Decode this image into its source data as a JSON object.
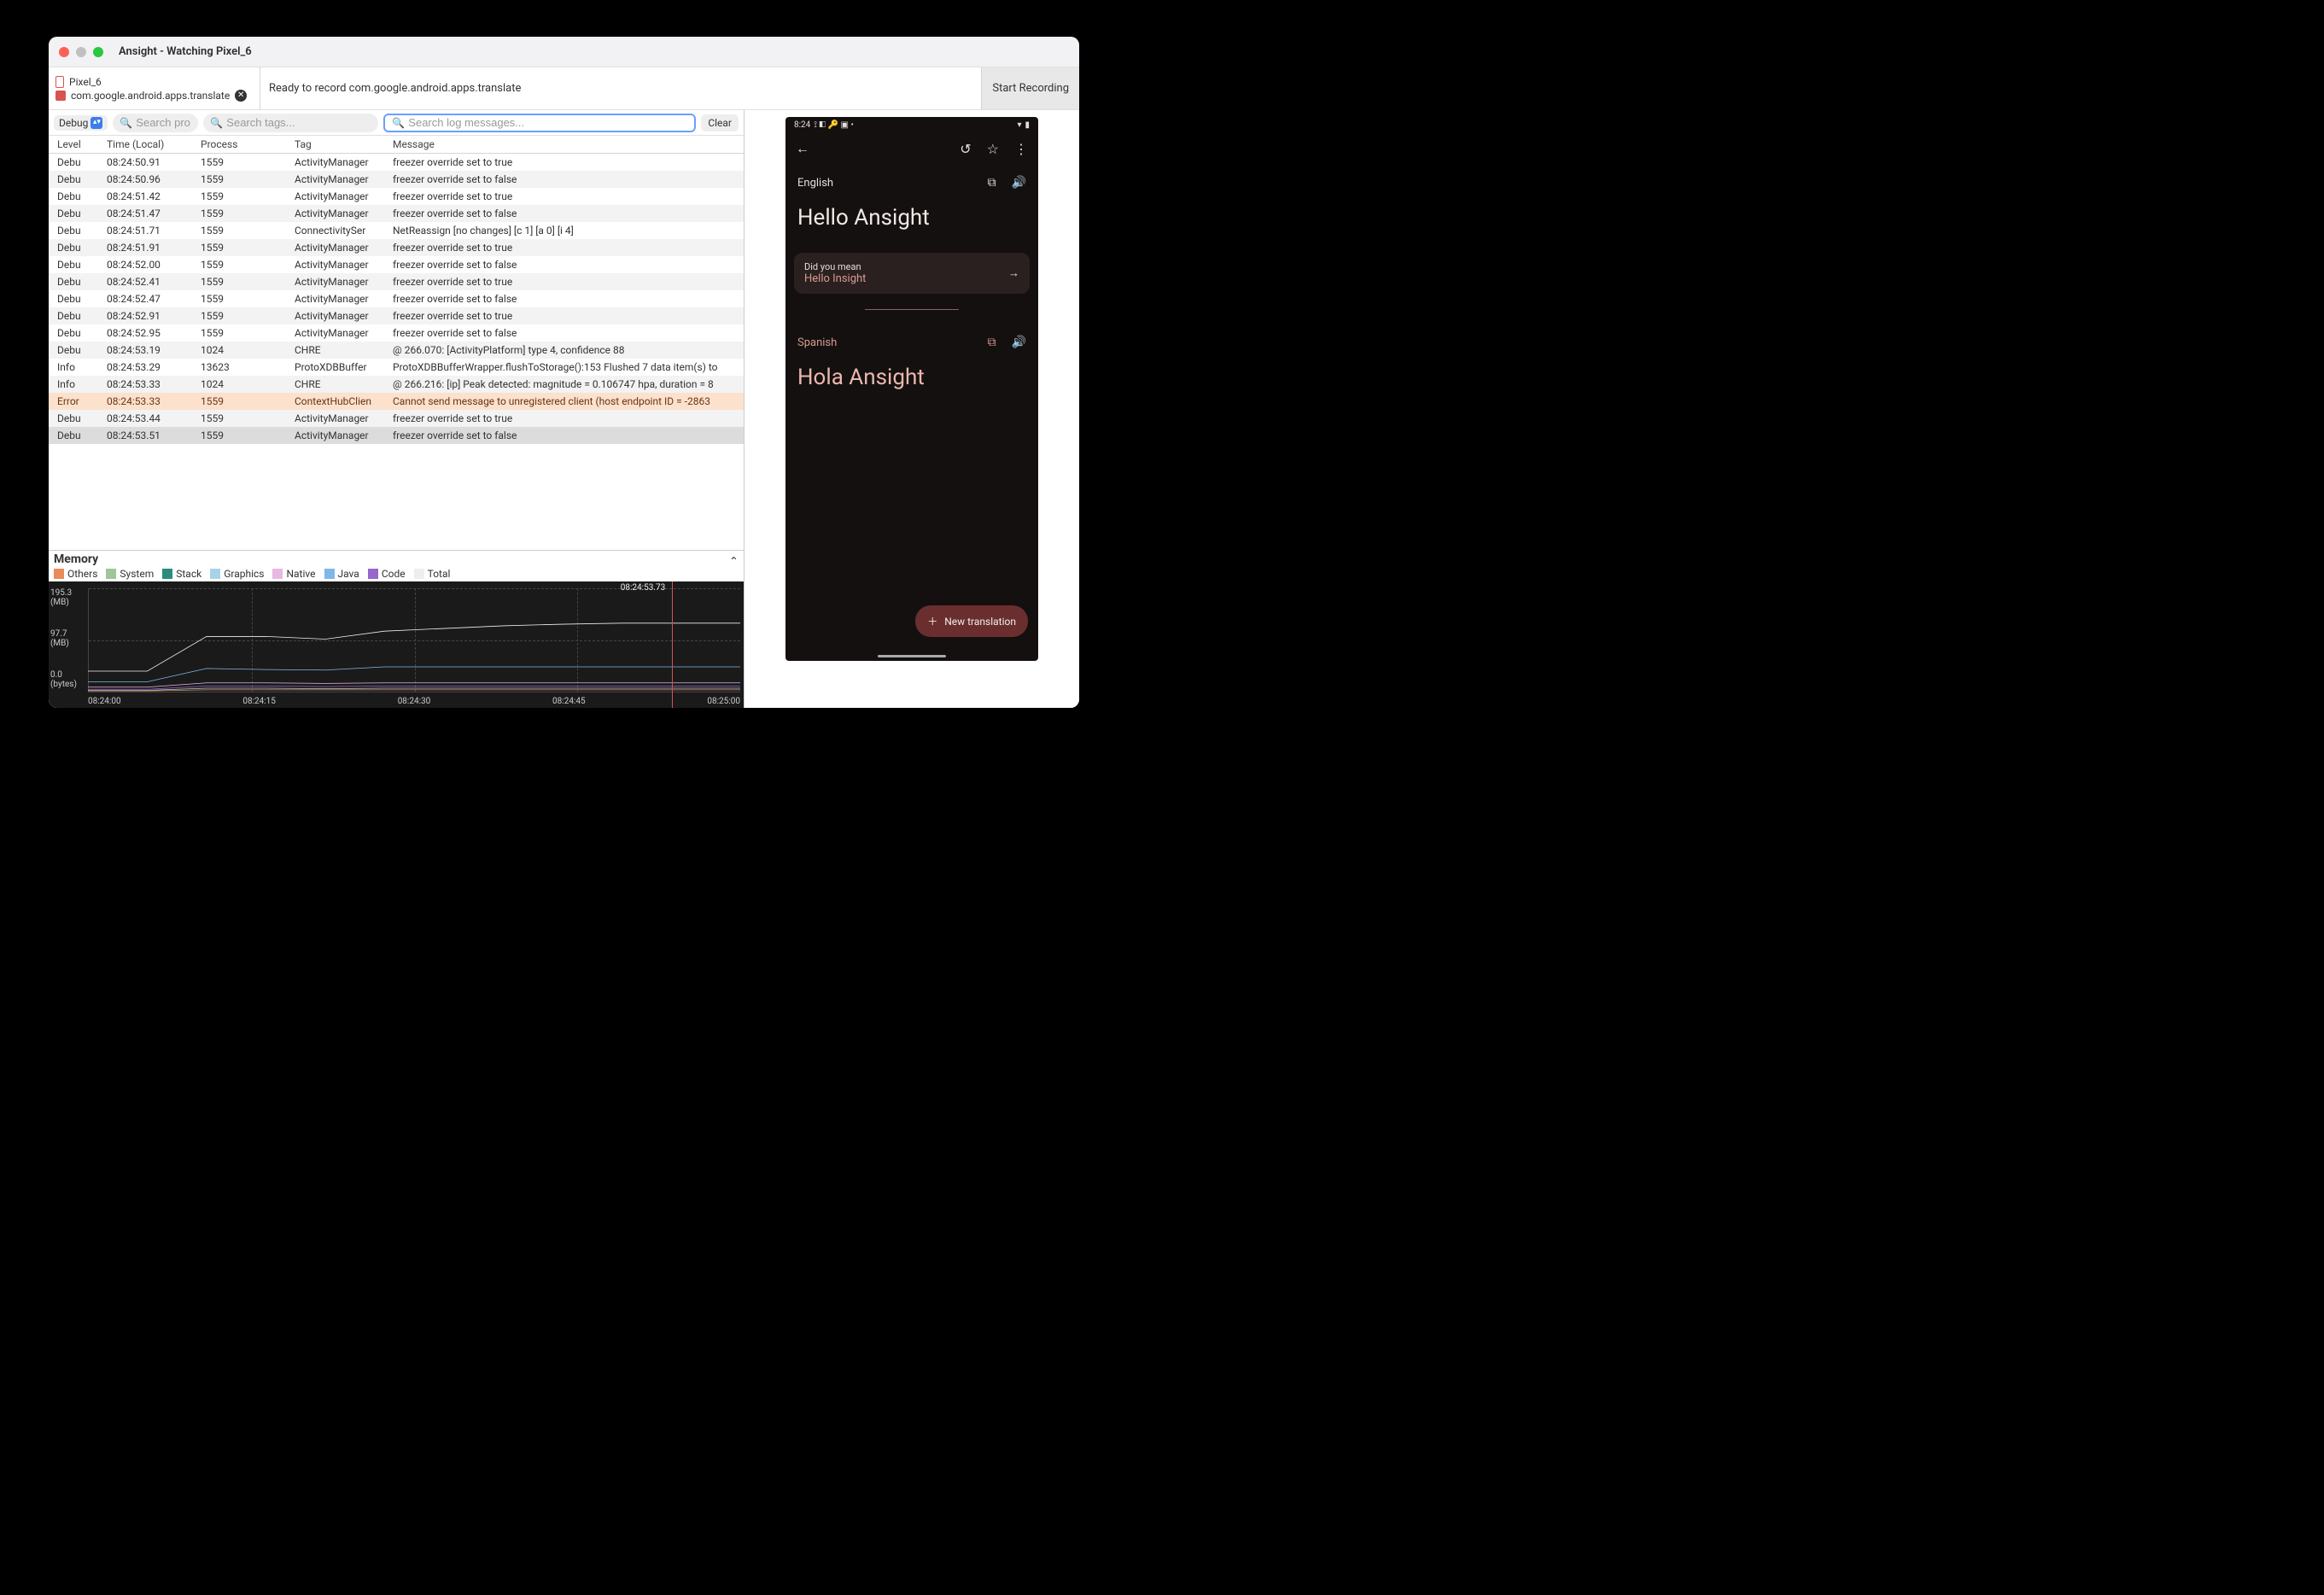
{
  "window": {
    "title": "Ansight - Watching Pixel_6"
  },
  "toolbar": {
    "device": "Pixel_6",
    "package": "com.google.android.apps.translate",
    "status": "Ready to record com.google.android.apps.translate",
    "start_recording": "Start Recording"
  },
  "filter": {
    "level": "Debug",
    "procs_placeholder": "Search pro",
    "tags_placeholder": "Search tags...",
    "logs_placeholder": "Search log messages...",
    "clear": "Clear"
  },
  "columns": {
    "level": "Level",
    "time": "Time (Local)",
    "process": "Process",
    "tag": "Tag",
    "message": "Message"
  },
  "logs": [
    {
      "lvl": "Debu",
      "time": "08:24:50.91",
      "proc": "1559",
      "tag": "ActivityManager",
      "msg": "freezer override set to true",
      "alt": false
    },
    {
      "lvl": "Debu",
      "time": "08:24:50.96",
      "proc": "1559",
      "tag": "ActivityManager",
      "msg": "freezer override set to false",
      "alt": true
    },
    {
      "lvl": "Debu",
      "time": "08:24:51.42",
      "proc": "1559",
      "tag": "ActivityManager",
      "msg": "freezer override set to true",
      "alt": false
    },
    {
      "lvl": "Debu",
      "time": "08:24:51.47",
      "proc": "1559",
      "tag": "ActivityManager",
      "msg": "freezer override set to false",
      "alt": true
    },
    {
      "lvl": "Debu",
      "time": "08:24:51.71",
      "proc": "1559",
      "tag": "ConnectivitySer",
      "msg": "NetReassign [no changes] [c 1] [a 0] [i 4]",
      "alt": false
    },
    {
      "lvl": "Debu",
      "time": "08:24:51.91",
      "proc": "1559",
      "tag": "ActivityManager",
      "msg": "freezer override set to true",
      "alt": true
    },
    {
      "lvl": "Debu",
      "time": "08:24:52.00",
      "proc": "1559",
      "tag": "ActivityManager",
      "msg": "freezer override set to false",
      "alt": false
    },
    {
      "lvl": "Debu",
      "time": "08:24:52.41",
      "proc": "1559",
      "tag": "ActivityManager",
      "msg": "freezer override set to true",
      "alt": true
    },
    {
      "lvl": "Debu",
      "time": "08:24:52.47",
      "proc": "1559",
      "tag": "ActivityManager",
      "msg": "freezer override set to false",
      "alt": false
    },
    {
      "lvl": "Debu",
      "time": "08:24:52.91",
      "proc": "1559",
      "tag": "ActivityManager",
      "msg": "freezer override set to true",
      "alt": true
    },
    {
      "lvl": "Debu",
      "time": "08:24:52.95",
      "proc": "1559",
      "tag": "ActivityManager",
      "msg": "freezer override set to false",
      "alt": false
    },
    {
      "lvl": "Debu",
      "time": "08:24:53.19",
      "proc": "1024",
      "tag": "CHRE",
      "msg": "@ 266.070: [ActivityPlatform] type 4, confidence 88",
      "alt": true
    },
    {
      "lvl": "Info",
      "time": "08:24:53.29",
      "proc": "13623",
      "tag": "ProtoXDBBuffer",
      "msg": "ProtoXDBBufferWrapper.flushToStorage():153 Flushed 7 data item(s) to",
      "alt": false
    },
    {
      "lvl": "Info",
      "time": "08:24:53.33",
      "proc": "1024",
      "tag": "CHRE",
      "msg": "@ 266.216: [ip] Peak detected: magnitude = 0.106747 hpa, duration = 8",
      "alt": true
    },
    {
      "lvl": "Error",
      "time": "08:24:53.33",
      "proc": "1559",
      "tag": "ContextHubClien",
      "msg": "Cannot send message to unregistered client (host endpoint ID = -2863",
      "error": true
    },
    {
      "lvl": "Debu",
      "time": "08:24:53.44",
      "proc": "1559",
      "tag": "ActivityManager",
      "msg": "freezer override set to true",
      "alt": true
    },
    {
      "lvl": "Debu",
      "time": "08:24:53.51",
      "proc": "1559",
      "tag": "ActivityManager",
      "msg": "freezer override set to false",
      "selected": true
    }
  ],
  "memory": {
    "title": "Memory",
    "legend": [
      {
        "name": "Others",
        "color": "#e98b5a"
      },
      {
        "name": "System",
        "color": "#9fc59b"
      },
      {
        "name": "Stack",
        "color": "#2a8c7d"
      },
      {
        "name": "Graphics",
        "color": "#a9d2e8"
      },
      {
        "name": "Native",
        "color": "#e7b8e0"
      },
      {
        "name": "Java",
        "color": "#7fb8e8"
      },
      {
        "name": "Code",
        "color": "#9966cc"
      },
      {
        "name": "Total",
        "color": "#eeeeee"
      }
    ],
    "cursor_time": "08:24:53.73"
  },
  "chart_data": {
    "type": "line",
    "title": "Memory",
    "ylabel": "(MB)",
    "ylim": [
      0,
      195.3
    ],
    "y_ticks": [
      "195.3\n(MB)",
      "97.7\n(MB)",
      "0.0\n(bytes)"
    ],
    "x": [
      "08:24:00",
      "08:24:15",
      "08:24:30",
      "08:24:45",
      "08:25:00"
    ],
    "series": [
      {
        "name": "Total",
        "color": "#eeeeee",
        "values": [
          40,
          40,
          105,
          105,
          100,
          115,
          120,
          125,
          128,
          130,
          130,
          130
        ]
      },
      {
        "name": "Java",
        "color": "#7fb8e8",
        "values": [
          20,
          20,
          45,
          43,
          42,
          48,
          48,
          48,
          48,
          48,
          48,
          48
        ]
      },
      {
        "name": "Native",
        "color": "#e7b8e0",
        "values": [
          10,
          10,
          18,
          18,
          17,
          18,
          18,
          18,
          18,
          18,
          18,
          18
        ]
      },
      {
        "name": "Code",
        "color": "#9966cc",
        "values": [
          6,
          6,
          12,
          12,
          11,
          12,
          12,
          12,
          12,
          12,
          12,
          12
        ]
      },
      {
        "name": "Graphics",
        "color": "#a9d2e8",
        "values": [
          4,
          4,
          8,
          8,
          7,
          8,
          8,
          8,
          8,
          8,
          8,
          8
        ]
      },
      {
        "name": "Others",
        "color": "#e98b5a",
        "values": [
          3,
          3,
          5,
          5,
          5,
          5,
          5,
          5,
          5,
          5,
          5,
          5
        ]
      }
    ],
    "cursor_x_frac": 0.895,
    "cursor_label": "08:24:53.73"
  },
  "phone": {
    "clock": "8:24",
    "src_lang": "English",
    "src_text": "Hello Ansight",
    "suggest_label": "Did you mean",
    "suggest_text": "Hello Insight",
    "dst_lang": "Spanish",
    "dst_text": "Hola Ansight",
    "new_translation": "New translation"
  }
}
